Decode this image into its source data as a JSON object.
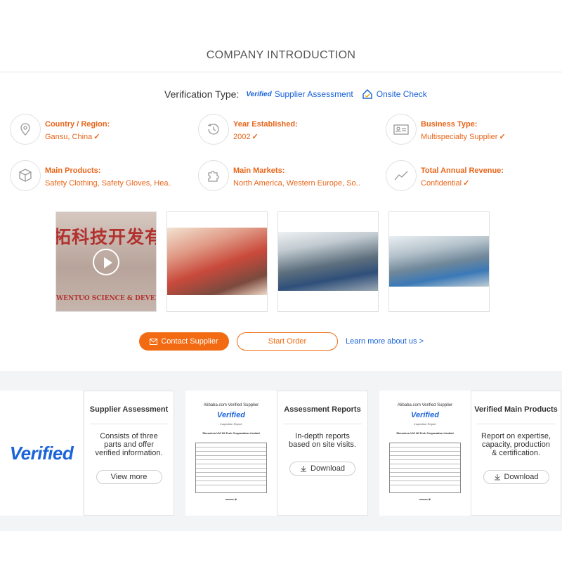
{
  "section_title": "COMPANY INTRODUCTION",
  "verification": {
    "label": "Verification Type:",
    "verified_logo": "Verified",
    "supplier_assessment": "Supplier Assessment",
    "onsite_check": "Onsite Check"
  },
  "info": [
    {
      "icon": "location-pin-icon",
      "label": "Country / Region:",
      "value": "Gansu, China"
    },
    {
      "icon": "history-clock-icon",
      "label": "Year Established:",
      "value": "2002"
    },
    {
      "icon": "business-card-icon",
      "label": "Business Type:",
      "value": "Multispecialty Supplier"
    },
    {
      "icon": "box-icon",
      "label": "Main Products:",
      "value": "Safety Clothing, Safety Gloves, Hea..."
    },
    {
      "icon": "puzzle-icon",
      "label": "Main Markets:",
      "value": "North America, Western Europe, So..."
    },
    {
      "icon": "trend-chart-icon",
      "label": "Total Annual Revenue:",
      "value": "Confidential"
    }
  ],
  "photos": {
    "sign_cn": "拓科技开发有限",
    "sign_en": "WENTUO SCIENCE & DEVELOPMENT"
  },
  "actions": {
    "contact": "Contact Supplier",
    "order": "Start Order",
    "learn_more": "Learn more about us >"
  },
  "cards": {
    "big_verified": "Verified",
    "supplier_assessment": {
      "title": "Supplier Assessment",
      "desc": "Consists of three parts and offer verified information.",
      "button": "View more"
    },
    "assessment_reports": {
      "title": "Assessment Reports",
      "desc": "In-depth reports based on site visits.",
      "button": "Download"
    },
    "verified_main_products": {
      "title": "Verified Main Products",
      "desc": "Report on expertise, capacity, production & certification.",
      "button": "Download"
    },
    "report": {
      "head": "Alibaba.com Verified Supplier",
      "verified": "Verified",
      "sub": "Inspection Report",
      "company": "Shenzhen UVI Hi-Tech Corporation Limited"
    }
  },
  "colors": {
    "accent": "#f26b12",
    "link": "#1a63d8",
    "band": "#f3f4f6"
  }
}
